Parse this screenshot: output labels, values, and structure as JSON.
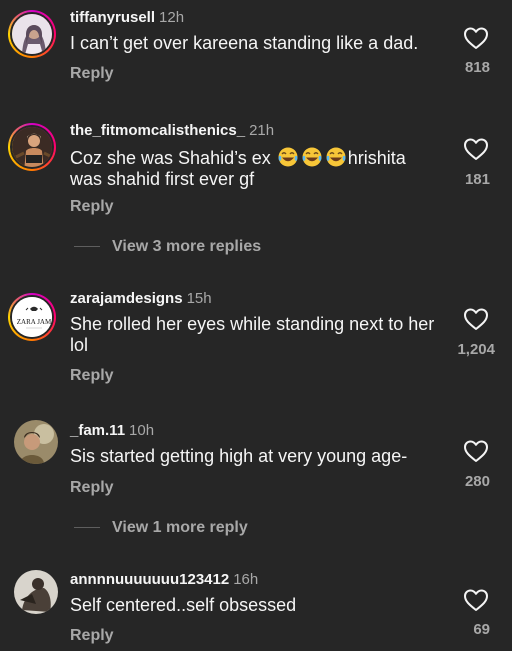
{
  "comments": [
    {
      "username": "tiffanyrusell",
      "time": "12h",
      "text": "I can’t get over kareena standing like a dad.",
      "reply_label": "Reply",
      "likes": "818"
    },
    {
      "username": "the_fitmomcalisthenics_",
      "time": "21h",
      "text_before": "Coz she was Shahid’s ex ",
      "text_after": "hrishita was shahid first ever gf",
      "emojis": [
        "face-with-tears-of-joy",
        "face-with-tears-of-joy",
        "face-with-tears-of-joy"
      ],
      "reply_label": "Reply",
      "likes": "181",
      "view_replies": "View 3 more replies"
    },
    {
      "username": "zarajamdesigns",
      "time": "15h",
      "text": "She rolled her eyes while standing next to her lol",
      "reply_label": "Reply",
      "likes": "1,204",
      "avatar_text": "ZARA JAM"
    },
    {
      "username": "_fam.11",
      "time": "10h",
      "text": "Sis started getting high at very young age-",
      "reply_label": "Reply",
      "likes": "280",
      "view_replies": "View 1 more reply"
    },
    {
      "username": "annnnuuuuuuu123412",
      "time": "16h",
      "text": "Self centered..self obsessed",
      "reply_label": "Reply",
      "likes": "69"
    }
  ],
  "icons": {
    "like": "heart-outline-icon",
    "emoji": "face-with-tears-of-joy"
  },
  "colors": {
    "background": "#262626",
    "primary_text": "#f5f5f5",
    "secondary_text": "#a8a8a8",
    "story_ring": [
      "#d300c5",
      "#ff0069",
      "#ff7a00",
      "#ffd600"
    ]
  }
}
